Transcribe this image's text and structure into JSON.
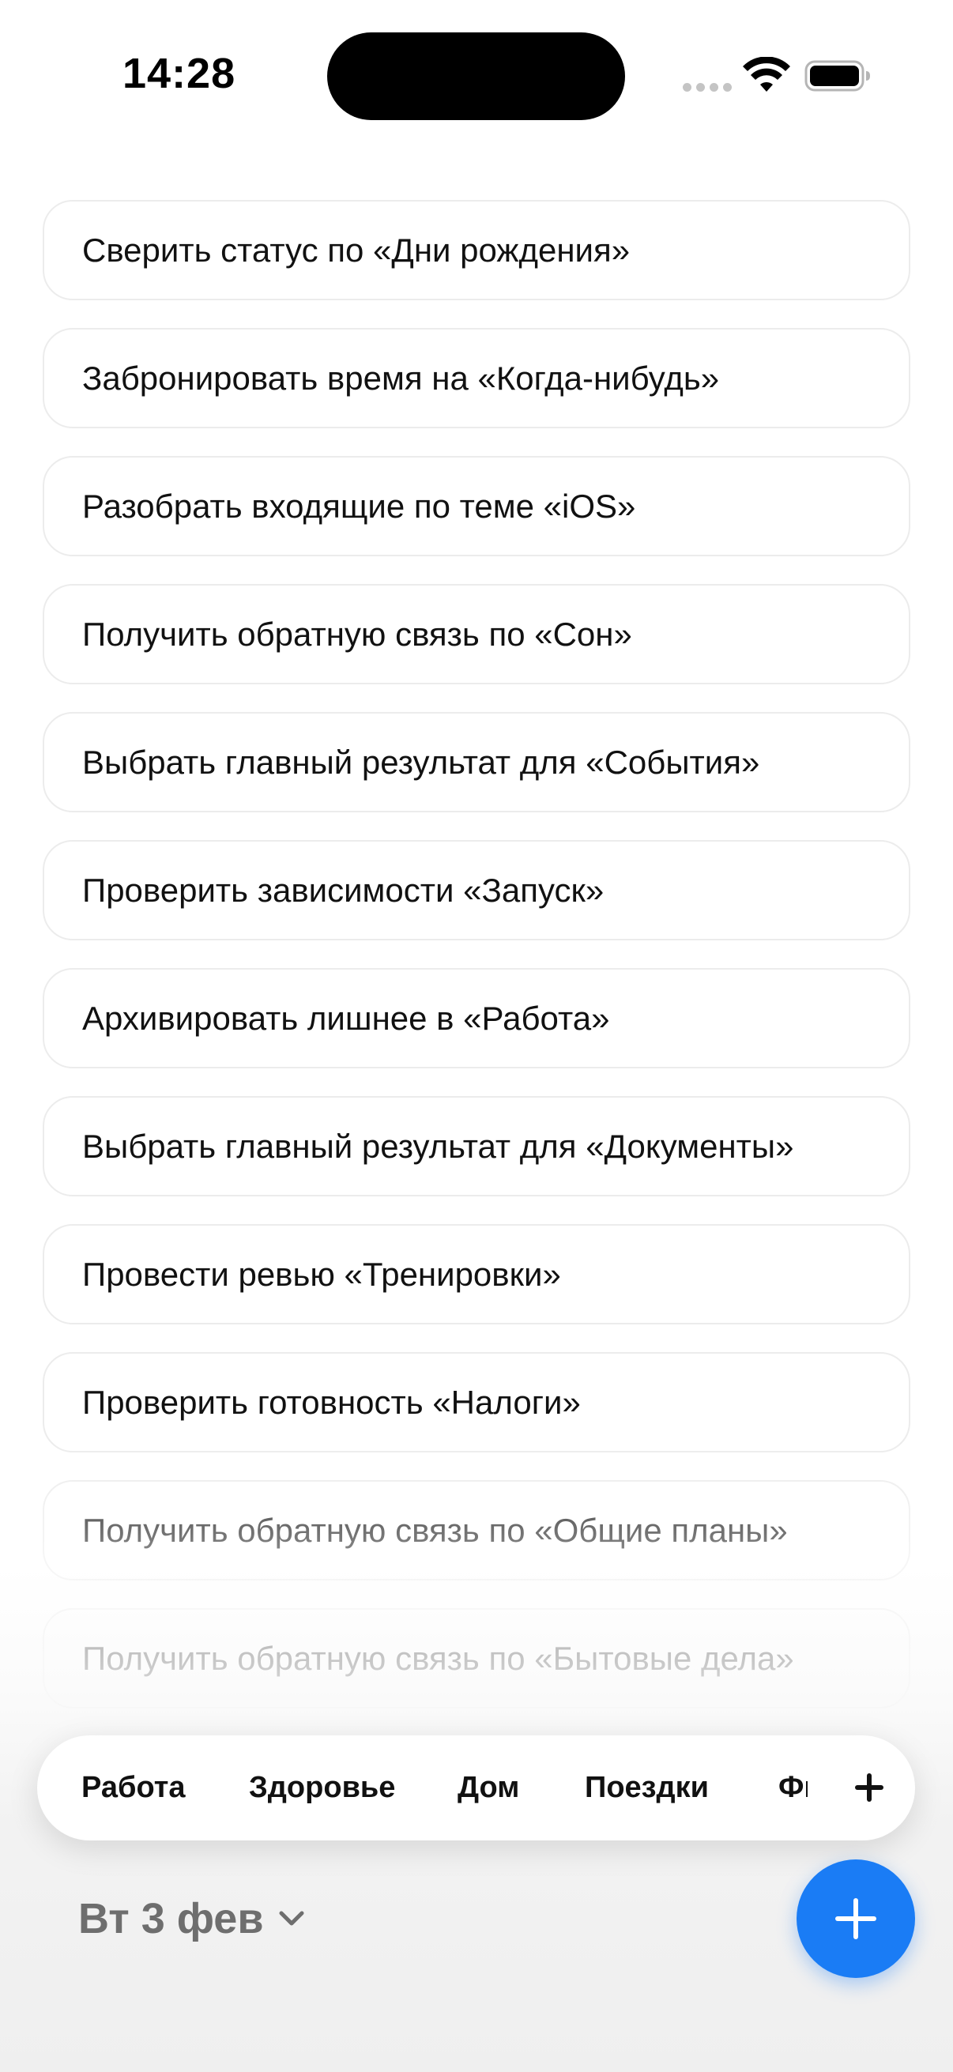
{
  "status_bar": {
    "time": "14:28"
  },
  "tasks": [
    {
      "label": "Сверить статус по «Дни рождения»"
    },
    {
      "label": "Забронировать время на «Когда-нибудь»"
    },
    {
      "label": "Разобрать входящие по теме «iOS»"
    },
    {
      "label": "Получить обратную связь по «Сон»"
    },
    {
      "label": "Выбрать главный результат для «События»"
    },
    {
      "label": "Проверить зависимости «Запуск»"
    },
    {
      "label": "Архивировать лишнее в «Работа»"
    },
    {
      "label": "Выбрать главный результат для «Документы»"
    },
    {
      "label": "Провести ревью «Тренировки»"
    },
    {
      "label": "Проверить готовность «Налоги»"
    },
    {
      "label": "Получить обратную связь по «Общие планы»"
    },
    {
      "label": "Получить обратную связь по «Бытовые дела»"
    }
  ],
  "categories": [
    {
      "label": "Работа"
    },
    {
      "label": "Здоровье"
    },
    {
      "label": "Дом"
    },
    {
      "label": "Поездки"
    },
    {
      "label": "Фи"
    }
  ],
  "date_picker": {
    "label": "Вт 3 фев"
  },
  "colors": {
    "accent": "#1a7cf5",
    "text": "#111111",
    "muted": "#6e6e6e"
  },
  "icons": {
    "add_category": "plus-icon",
    "fab": "plus-icon",
    "date": "chevron-down-icon"
  }
}
